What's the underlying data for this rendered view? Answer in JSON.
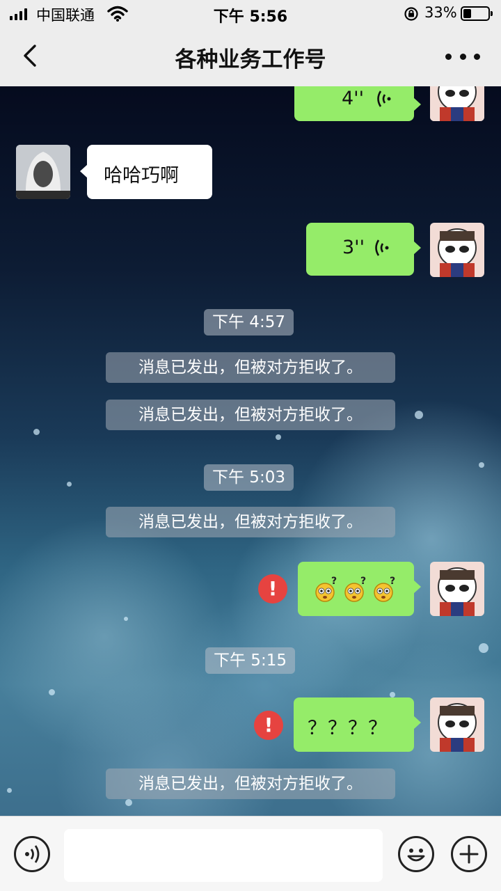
{
  "status_bar": {
    "carrier": "中国联通",
    "time": "下午 5:56",
    "battery": "33%",
    "battery_level": 0.33
  },
  "nav": {
    "title": "各种业务工作号",
    "back_icon": "chevron-left-icon",
    "more_icon": "more-dots-icon"
  },
  "messages": {
    "voice_1": "4''",
    "friend_text": "哈哈巧啊",
    "voice_2": "3''",
    "time_1": "下午 4:57",
    "rejected_1": "消息已发出，但被对方拒收了。",
    "rejected_2": "消息已发出，但被对方拒收了。",
    "time_2": "下午 5:03",
    "rejected_3": "消息已发出，但被对方拒收了。",
    "emoji_msg_icon": "confused-emoji-icon",
    "time_3": "下午 5:15",
    "question_text": "？？？？",
    "rejected_4": "消息已发出，但被对方拒收了。",
    "send_failed_icon": "exclamation-icon"
  },
  "colors": {
    "sent_bubble": "#95ec69",
    "error_red": "#e64340"
  },
  "input_bar": {
    "voice_icon": "voice-input-icon",
    "emoji_icon": "smiley-icon",
    "plus_icon": "plus-icon"
  }
}
